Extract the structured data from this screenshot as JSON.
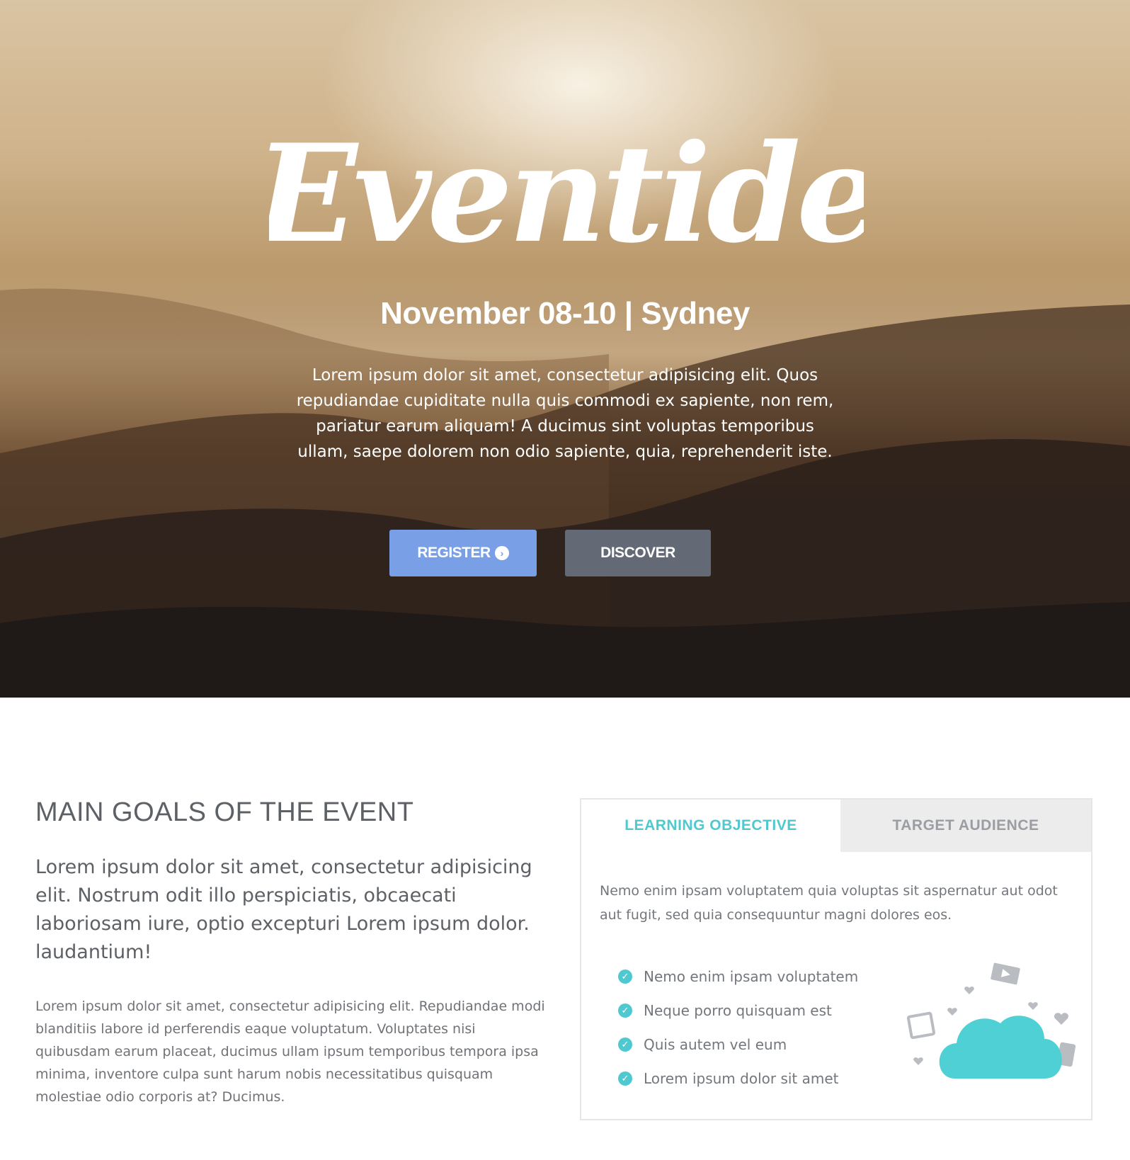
{
  "hero": {
    "logo_text": "Eventide",
    "date_location": "November 08-10 | Sydney",
    "description": "Lorem ipsum dolor sit amet, consectetur adipisicing elit. Quos repudiandae cupiditate nulla quis commodi ex sapiente, non rem, pariatur earum aliquam! A ducimus sint voluptas temporibus ullam, saepe dolorem non odio sapiente, quia, reprehenderit iste.",
    "register_label": "REGISTER",
    "register_icon": "chevron-circle-right-icon",
    "discover_label": "DISCOVER"
  },
  "goals": {
    "title": "MAIN GOALS OF THE EVENT",
    "lead": "Lorem ipsum dolor sit amet, consectetur adipisicing elit. Nostrum odit illo perspiciatis, obcaecati laboriosam iure, optio excepturi Lorem ipsum dolor. laudantium!",
    "body": "Lorem ipsum dolor sit amet, consectetur adipisicing elit. Repudiandae modi blanditiis labore id perferendis eaque voluptatum. Voluptates nisi quibusdam earum placeat, ducimus ullam ipsum temporibus tempora ipsa minima, inventore culpa sunt harum nobis necessitatibus quisquam molestiae odio corporis at? Ducimus."
  },
  "panel": {
    "tabs": [
      {
        "label": "LEARNING OBJECTIVE",
        "active": true
      },
      {
        "label": "TARGET AUDIENCE",
        "active": false
      }
    ],
    "text": "Nemo enim ipsam voluptatem quia voluptas sit aspernatur aut odot aut fugit, sed quia consequuntur magni dolores eos.",
    "checklist": [
      "Nemo enim ipsam voluptatem",
      "Neque porro quisquam est",
      "Quis autem vel eum",
      "Lorem ipsum dolor sit amet"
    ],
    "illustration_icon": "cloud-icon"
  },
  "colors": {
    "accent_teal": "#4fc9cf",
    "register_blue": "#79a0e6",
    "discover_gray": "#636a75",
    "heading_gray": "#5d6166"
  }
}
